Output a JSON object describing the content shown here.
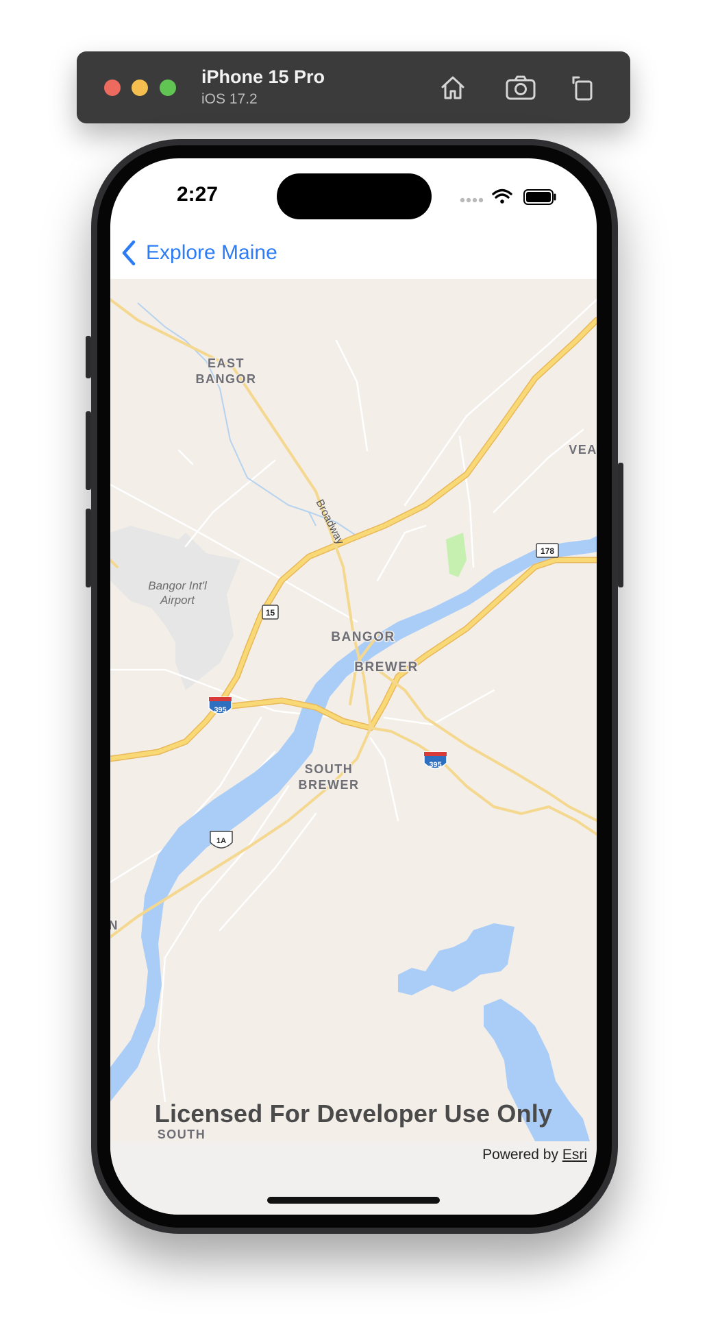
{
  "simulator": {
    "device_name": "iPhone 15 Pro",
    "os_version": "iOS 17.2",
    "toolbar_icons": [
      "home-icon",
      "screenshot-camera-icon",
      "rotate-icon"
    ]
  },
  "status_bar": {
    "time": "2:27",
    "icons": [
      "cellular-icon",
      "wifi-icon",
      "battery-icon"
    ]
  },
  "nav": {
    "back_label": "Explore Maine",
    "accent_color": "#2d7cf6"
  },
  "map": {
    "labels": {
      "east_bangor_1": "EAST",
      "east_bangor_2": "BANGOR",
      "vea": "VEA",
      "broadway": "Broadway",
      "airport_1": "Bangor Int'l",
      "airport_2": "Airport",
      "bangor": "BANGOR",
      "brewer": "BREWER",
      "south_brewer_1": "SOUTH",
      "south_brewer_2": "BREWER",
      "n_edge": "N",
      "south_bottom": "SOUTH"
    },
    "shields": {
      "route_15": "15",
      "route_178": "178",
      "interstate_395_a": "395",
      "interstate_395_b": "395",
      "us_1a": "1A"
    },
    "colors": {
      "land": "#f3eee8",
      "water": "#aacdf8",
      "highway": "#f7d26f",
      "airport": "#e6e6e6",
      "park": "#c6f0b0"
    }
  },
  "license_text": "Licensed For Developer Use Only",
  "attribution": {
    "prefix": "Powered by",
    "link": "Esri"
  }
}
